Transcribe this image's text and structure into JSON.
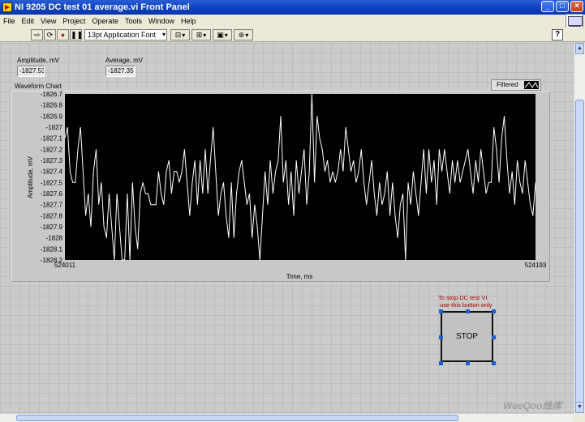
{
  "window": {
    "title": "NI 9205 DC test 01 average.vi Front Panel"
  },
  "menu": [
    "File",
    "Edit",
    "View",
    "Project",
    "Operate",
    "Tools",
    "Window",
    "Help"
  ],
  "toolbar": {
    "font": "13pt Application Font"
  },
  "indicators": [
    {
      "label": "Amplitude, mV",
      "value": "-1827.53"
    },
    {
      "label": "Average, mV",
      "value": "-1827.35"
    }
  ],
  "chart_data": {
    "type": "line",
    "title": "Waveform Chart",
    "xlabel": "Time, ms",
    "ylabel": "Amplitude, mV",
    "xlim": [
      524011,
      524193
    ],
    "ylim": [
      -1828.2,
      -1826.7
    ],
    "x_tick_labels": [
      "524011",
      "524193"
    ],
    "y_ticks": [
      -1826.7,
      -1826.8,
      -1826.9,
      -1827,
      -1827.1,
      -1827.2,
      -1827.3,
      -1827.4,
      -1827.5,
      -1827.6,
      -1827.7,
      -1827.8,
      -1827.9,
      -1828,
      -1828.1,
      -1828.2
    ],
    "y_tick_labels": [
      "-1826.7",
      "-1826.8",
      "-1826.9",
      "-1827",
      "-1827.1",
      "-1827.2",
      "-1827.3",
      "-1827.4",
      "-1827.5",
      "-1827.6",
      "-1827.7",
      "-1827.8",
      "-1827.9",
      "-1828",
      "-1828.1",
      "-1828.2"
    ],
    "legend": "top-right",
    "grid": false,
    "background": "#000000",
    "series": [
      {
        "name": "Filtered",
        "color": "#ffffff",
        "values": [
          -1827.1,
          -1827.0,
          -1827.4,
          -1827.5,
          -1827.5,
          -1827.2,
          -1827.0,
          -1827.4,
          -1827.8,
          -1827.6,
          -1827.9,
          -1827.4,
          -1827.2,
          -1827.7,
          -1827.5,
          -1827.9,
          -1828.0,
          -1827.6,
          -1827.9,
          -1828.2,
          -1827.6,
          -1827.9,
          -1828.2,
          -1828.2,
          -1827.6,
          -1828.2,
          -1827.5,
          -1827.9,
          -1828.1,
          -1827.6,
          -1827.5,
          -1827.6,
          -1827.6,
          -1827.7,
          -1827.7,
          -1827.7,
          -1827.4,
          -1827.6,
          -1827.7,
          -1827.4,
          -1827.3,
          -1827.6,
          -1827.4,
          -1827.4,
          -1827.5,
          -1827.4,
          -1827.2,
          -1827.5,
          -1827.8,
          -1827.5,
          -1827.3,
          -1827.7,
          -1827.3,
          -1827.6,
          -1827.2,
          -1827.6,
          -1827.3,
          -1827.0,
          -1827.4,
          -1827.8,
          -1827.6,
          -1827.5,
          -1827.8,
          -1828.0,
          -1827.5,
          -1828.0,
          -1827.6,
          -1827.4,
          -1827.3,
          -1827.5,
          -1827.7,
          -1827.6,
          -1828.0,
          -1827.7,
          -1827.9,
          -1828.2,
          -1827.8,
          -1827.4,
          -1827.7,
          -1827.3,
          -1827.6,
          -1827.4,
          -1827.3,
          -1826.9,
          -1827.5,
          -1827.3,
          -1827.7,
          -1827.4,
          -1827.8,
          -1827.3,
          -1827.6,
          -1827.4,
          -1827.2,
          -1827.7,
          -1827.4,
          -1826.7,
          -1827.5,
          -1826.9,
          -1827.1,
          -1827.2,
          -1827.4,
          -1827.3,
          -1827.5,
          -1827.4,
          -1827.5,
          -1827.4,
          -1827.2,
          -1827.4,
          -1827.0,
          -1827.2,
          -1827.4,
          -1827.3,
          -1827.5,
          -1827.4,
          -1827.2,
          -1827.5,
          -1827.7,
          -1827.5,
          -1827.3,
          -1827.6,
          -1827.8,
          -1827.5,
          -1827.7,
          -1827.6,
          -1827.4,
          -1827.8,
          -1827.5,
          -1827.8,
          -1828.0,
          -1827.7,
          -1827.6,
          -1828.2,
          -1827.5,
          -1827.7,
          -1827.4,
          -1827.6,
          -1827.8,
          -1827.5,
          -1827.2,
          -1827.6,
          -1827.2,
          -1827.5,
          -1827.3,
          -1827.7,
          -1827.2,
          -1827.4,
          -1827.2,
          -1827.4,
          -1827.6,
          -1827.3,
          -1827.5,
          -1827.3,
          -1827.5,
          -1827.4,
          -1827.3,
          -1827.2,
          -1827.4,
          -1827.6,
          -1827.3,
          -1827.5,
          -1827.2,
          -1827.4,
          -1827.6,
          -1827.5,
          -1827.5,
          -1827.0,
          -1827.2,
          -1827.5,
          -1827.1,
          -1826.9,
          -1827.3,
          -1827.6,
          -1827.4,
          -1827.7,
          -1827.3,
          -1827.5,
          -1827.6,
          -1827.3,
          -1827.5,
          -1827.7,
          -1827.8,
          -1827.5
        ]
      }
    ]
  },
  "legend_label": "Filtered",
  "stop": {
    "note_line1": "To stop DC test VI",
    "note_line2": "use this button only",
    "label": "STOP"
  },
  "watermark": "WeeQoo维库"
}
